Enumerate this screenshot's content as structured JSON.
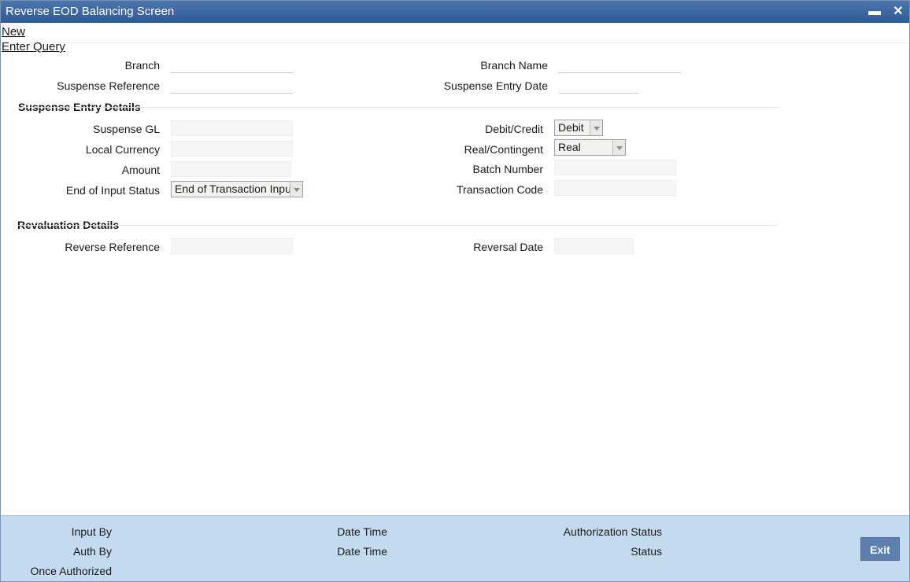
{
  "window": {
    "title": "Reverse EOD Balancing Screen",
    "minimize_glyph": "▬",
    "close_glyph": "✕"
  },
  "menu": {
    "new_label": "New",
    "enter_query_label": "Enter Query"
  },
  "header_fields": {
    "branch_label": "Branch",
    "branch_value": "",
    "branch_name_label": "Branch Name",
    "branch_name_value": "",
    "suspense_reference_label": "Suspense Reference",
    "suspense_reference_value": "",
    "suspense_entry_date_label": "Suspense Entry Date",
    "suspense_entry_date_value": ""
  },
  "suspense_entry_details": {
    "title": "Suspense Entry Details",
    "suspense_gl_label": "Suspense GL",
    "suspense_gl_value": "",
    "local_currency_label": "Local Currency",
    "local_currency_value": "",
    "amount_label": "Amount",
    "amount_value": "",
    "end_of_input_status_label": "End of Input Status",
    "end_of_input_status_value": "End of Transaction Input",
    "debit_credit_label": "Debit/Credit",
    "debit_credit_value": "Debit",
    "real_contingent_label": "Real/Contingent",
    "real_contingent_value": "Real",
    "batch_number_label": "Batch Number",
    "batch_number_value": "",
    "transaction_code_label": "Transaction Code",
    "transaction_code_value": ""
  },
  "revaluation_details": {
    "title": "Revaluation Details",
    "reverse_reference_label": "Reverse Reference",
    "reverse_reference_value": "",
    "reversal_date_label": "Reversal Date",
    "reversal_date_value": ""
  },
  "footer": {
    "input_by_label": "Input By",
    "auth_by_label": "Auth By",
    "once_authorized_label": "Once Authorized",
    "date_time_label_1": "Date Time",
    "date_time_label_2": "Date Time",
    "authorization_status_label": "Authorization Status",
    "status_label": "Status",
    "exit_label": "Exit"
  },
  "colors": {
    "titlebar": "#2f5a96",
    "footer_bg": "#c3daef",
    "exit_button": "#5c7fae"
  }
}
